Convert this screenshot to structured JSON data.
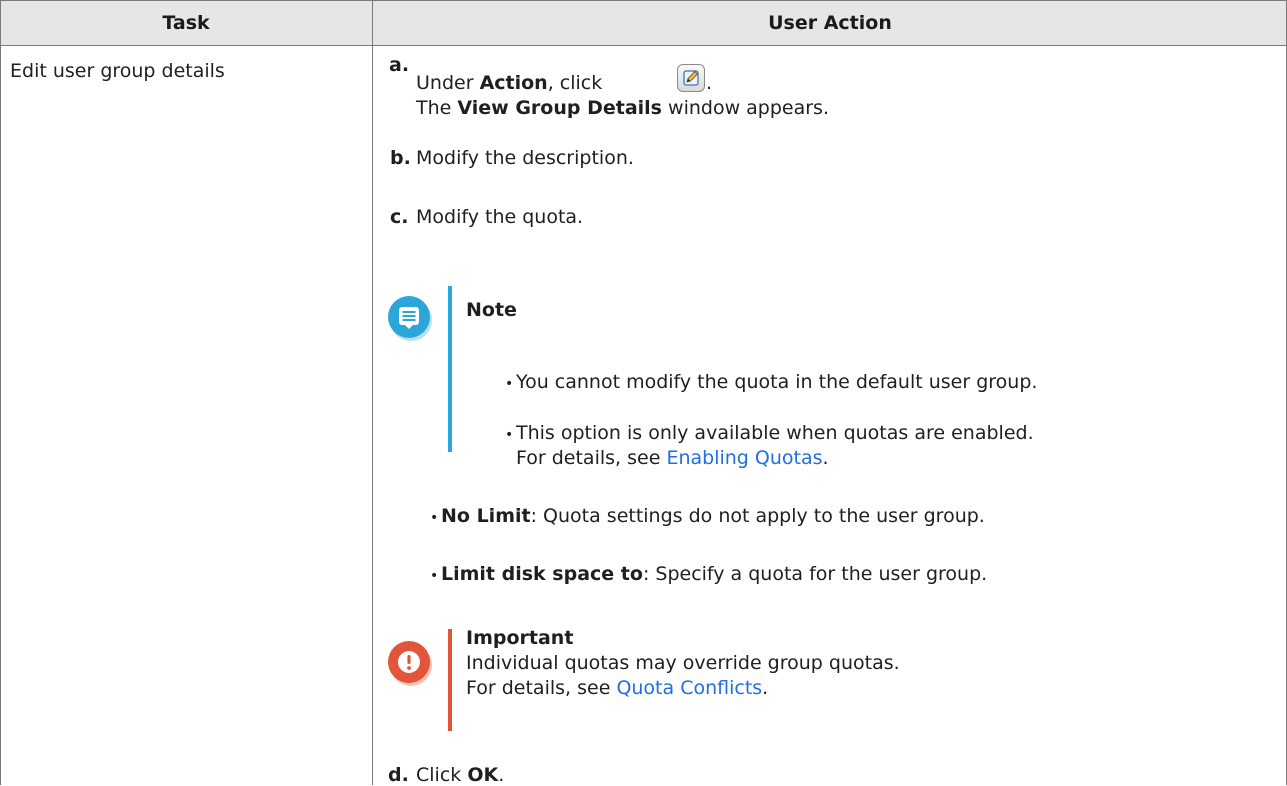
{
  "table": {
    "headers": {
      "task": "Task",
      "user_action": "User Action"
    },
    "task": "Edit user group details"
  },
  "steps": {
    "a": {
      "label": "a.",
      "line1_pre": "Under ",
      "line1_bold": "Action",
      "line1_post": ", click",
      "line1_end": ".",
      "icon": "edit-icon",
      "line2_pre": "The ",
      "line2_bold": "View Group Details",
      "line2_post": " window appears."
    },
    "b": {
      "label": "b.",
      "text": "Modify the description."
    },
    "c": {
      "label": "c.",
      "text": "Modify the quota."
    },
    "d": {
      "label": "d.",
      "text_pre": "Click ",
      "text_bold": "OK",
      "text_post": "."
    }
  },
  "note": {
    "title": "Note",
    "icon": "note-icon",
    "bullet1": "You cannot modify the quota in the default user group.",
    "bullet2_line1": "This option is only available when quotas are enabled.",
    "bullet2_line2_pre": "For details, see ",
    "bullet2_link": "Enabling Quotas",
    "bullet2_line2_post": "."
  },
  "options": {
    "no_limit_bold": "No Limit",
    "no_limit_text": ": Quota settings do not apply to the user group.",
    "limit_bold": "Limit disk space to",
    "limit_text": ": Specify a quota for the user group."
  },
  "important": {
    "title": "Important",
    "icon": "important-icon",
    "line1": "Individual quotas may override group quotas.",
    "line2_pre": "For details, see ",
    "link": "Quota Conflicts",
    "line2_post": "."
  },
  "colors": {
    "note": "#2aa7d8",
    "important": "#e2553b",
    "link": "#1e6fe0",
    "header_bg": "#e6e6e6"
  }
}
